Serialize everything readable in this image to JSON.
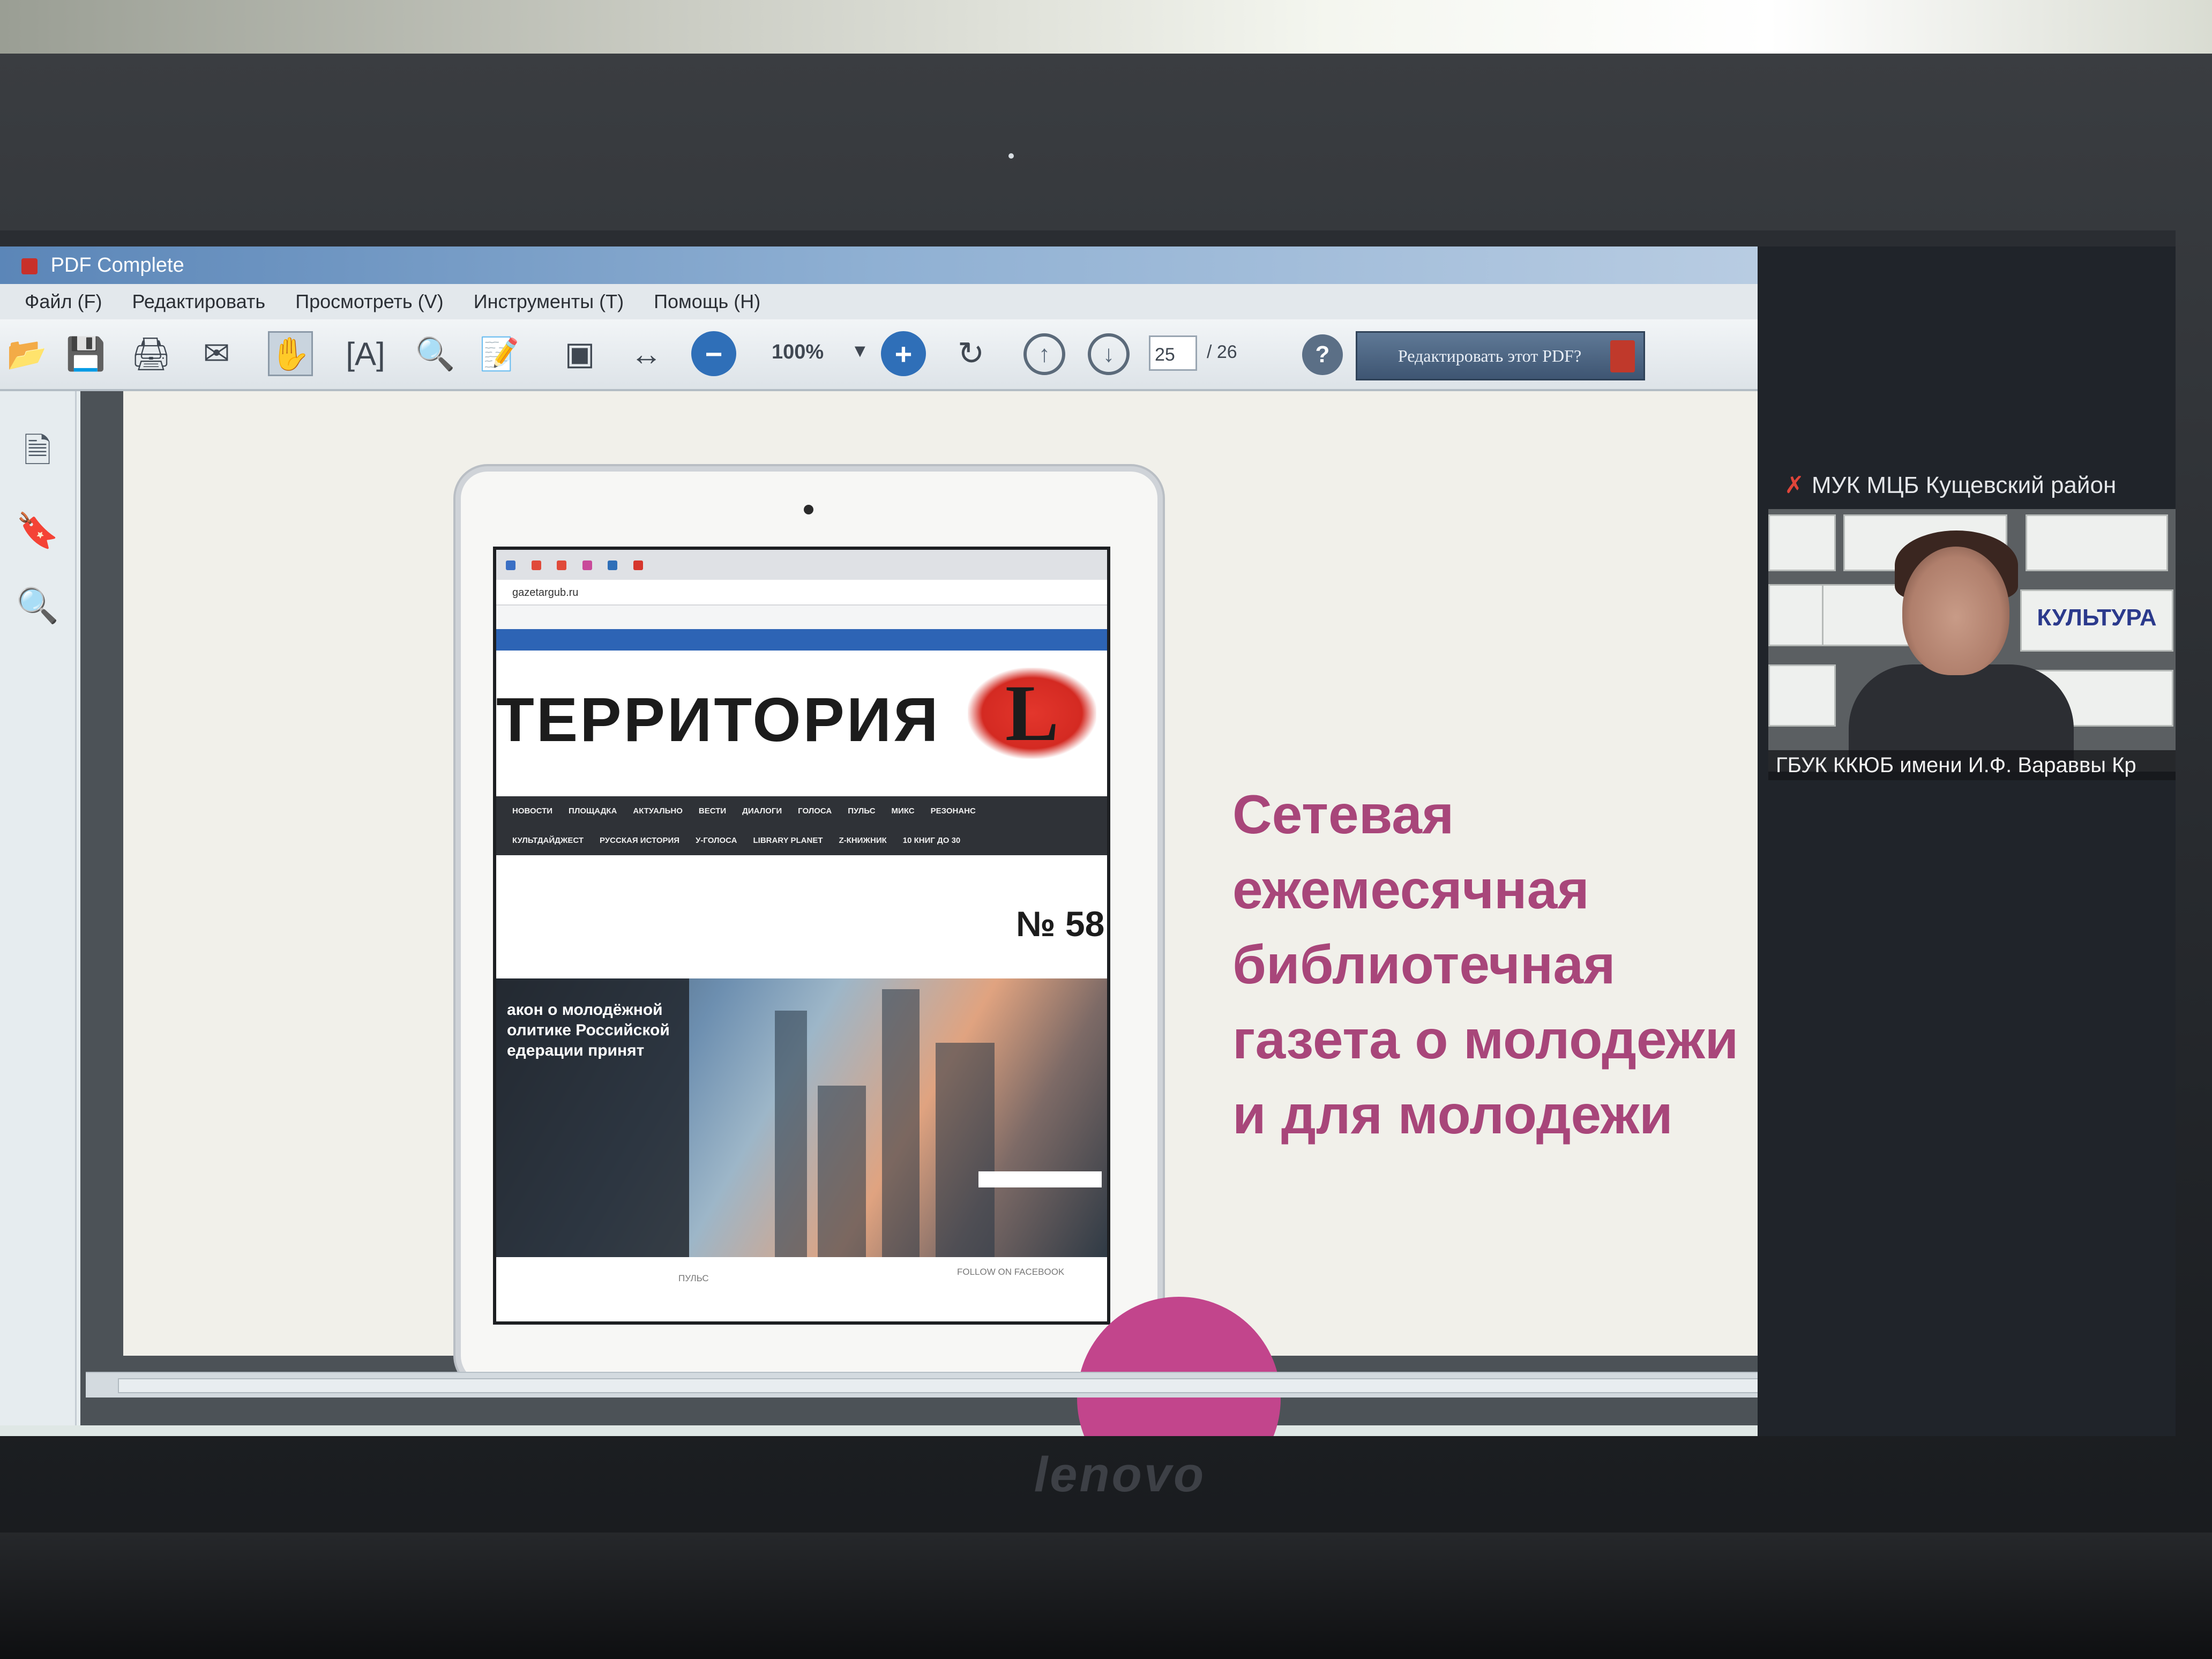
{
  "window": {
    "title": "",
    "app_name": "PDF Complete"
  },
  "menubar": {
    "items": [
      {
        "label": "Файл (F)"
      },
      {
        "label": "Редактировать"
      },
      {
        "label": "Просмотреть (V)"
      },
      {
        "label": "Инструменты (T)"
      },
      {
        "label": "Помощь (H)"
      }
    ]
  },
  "toolbar": {
    "zoom": "100%",
    "page_current": "25",
    "page_total": "/ 26",
    "edit_pdf_label": "Редактировать этот PDF?",
    "icons": {
      "open": "folder-open-icon",
      "save": "floppy-disk-icon",
      "print": "printer-icon",
      "email": "envelope-icon",
      "hand": "hand-tool-icon",
      "select_text": "text-select-icon",
      "zoom_tool": "magnifier-icon",
      "edit": "edit-document-icon",
      "fit_page": "fit-page-icon",
      "fit_width": "fit-width-icon",
      "zoom_out": "minus-circle-icon",
      "zoom_in": "plus-circle-icon",
      "rotate": "rotate-icon",
      "prev_page": "arrow-up-circle-icon",
      "next_page": "arrow-down-circle-icon",
      "help": "help-icon"
    },
    "accent_blue": "#2f6fb8"
  },
  "sidepanel": {
    "icons": [
      "pages-icon",
      "bookmark-icon",
      "search-icon"
    ]
  },
  "slide": {
    "headline_lines": [
      "Сетевая",
      "ежемесячная",
      "библиотечная",
      "газета о молодежи",
      "и для молодежи"
    ],
    "headline_color": "#a8467a",
    "accent_circle_color": "#c2458c",
    "tablet": {
      "browser_url": "gazetargub.ru",
      "site_title": "ТЕРРИТОРИЯ",
      "site_logo_letter": "L",
      "issue_number": "№ 58",
      "nav_row_1": [
        "НОВОСТИ",
        "ПЛОЩАДКА",
        "АКТУАЛЬНО",
        "ВЕСТИ",
        "ДИАЛОГИ",
        "ГОЛОСА",
        "ПУЛЬС",
        "МИКС",
        "РЕЗОНАНС"
      ],
      "nav_row_2": [
        "КУЛЬТДАЙДЖЕСТ",
        "РУССКАЯ ИСТОРИЯ",
        "У-ГОЛОСА",
        "LIBRARY PLANET",
        "Z-КНИЖНИК",
        "10 КНИГ ДО 30"
      ],
      "hero_headline": "акон о молодёжной олитике Российской едерации принят",
      "footer_left": "ПУЛЬС",
      "footer_right": "FOLLOW ON FACEBOOK"
    }
  },
  "call": {
    "top_participant": "МУК МЦБ Кущевский район",
    "bottom_participant": "ГБУК ККЮБ имени И.Ф. Вараввы Кр",
    "shelf_word": "КУЛЬТУРА",
    "mic_off_color": "#e0453a"
  },
  "monitor": {
    "brand": "lenovo"
  }
}
